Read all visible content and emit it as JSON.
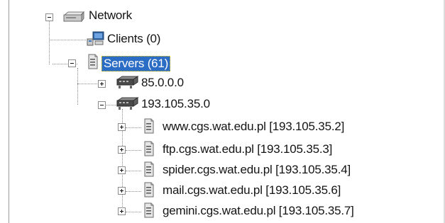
{
  "tree": {
    "root": {
      "label": "Network",
      "icon": "network-drive-icon",
      "expanded": true
    },
    "clients": {
      "label": "Clients (0)",
      "icon": "client-computer-icon"
    },
    "servers": {
      "label": "Servers (61)",
      "icon": "server-icon",
      "expanded": true,
      "selected": true,
      "subnets": [
        {
          "label": "85.0.0.0",
          "icon": "subnet-switch-icon",
          "expanded": false
        },
        {
          "label": "193.105.35.0",
          "icon": "subnet-switch-icon",
          "expanded": true,
          "hosts": [
            {
              "label": "www.cgs.wat.edu.pl [193.105.35.2]",
              "icon": "server-icon"
            },
            {
              "label": "ftp.cgs.wat.edu.pl [193.105.35.3]",
              "icon": "server-icon"
            },
            {
              "label": "spider.cgs.wat.edu.pl [193.105.35.4]",
              "icon": "server-icon"
            },
            {
              "label": "mail.cgs.wat.edu.pl [193.105.35.6]",
              "icon": "server-icon"
            },
            {
              "label": "gemini.cgs.wat.edu.pl [193.105.35.7]",
              "icon": "server-icon"
            }
          ]
        }
      ]
    }
  },
  "colors": {
    "selection": "#2b6cc4",
    "tree_lines": "#8a8a8a"
  }
}
